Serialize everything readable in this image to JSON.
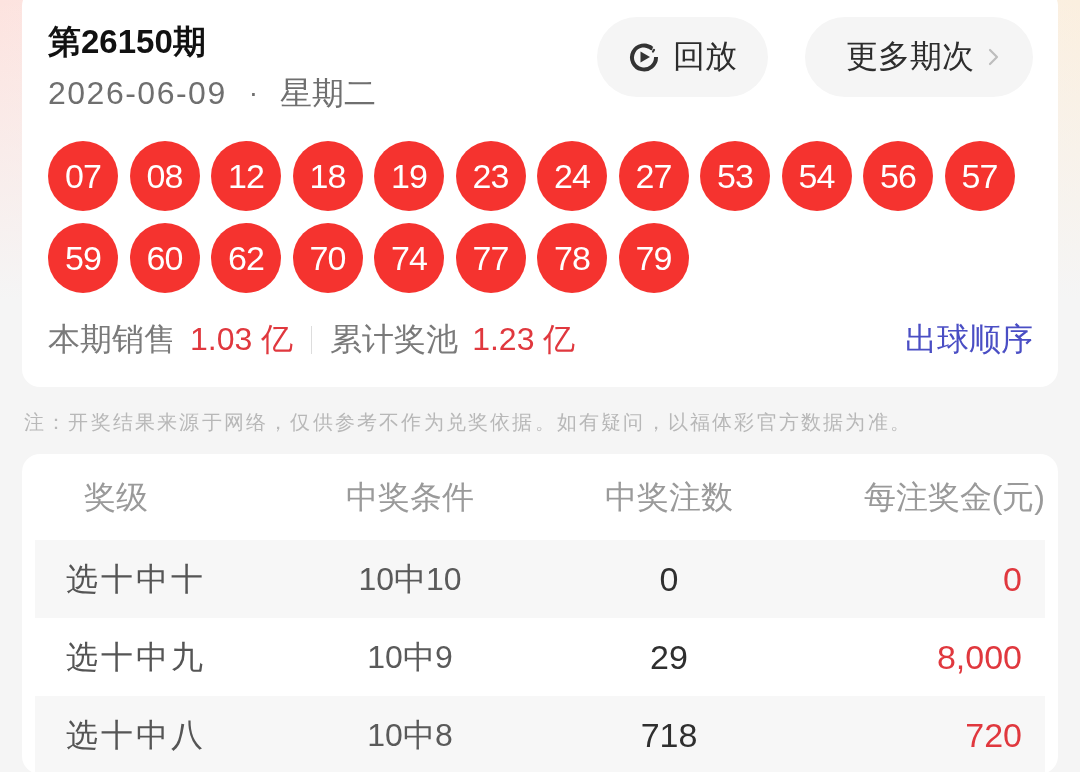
{
  "draw": {
    "issue": "第26150期",
    "date": "2026-06-09",
    "separator": "·",
    "weekday": "星期二"
  },
  "actions": [
    {
      "kind": "replay",
      "label": "回放"
    },
    {
      "kind": "more",
      "label": "更多期次"
    }
  ],
  "balls": [
    "07",
    "08",
    "12",
    "18",
    "19",
    "23",
    "24",
    "27",
    "53",
    "54",
    "56",
    "57",
    "59",
    "60",
    "62",
    "70",
    "74",
    "77",
    "78",
    "79"
  ],
  "stats": [
    {
      "label": "本期销售",
      "value": "1.03 亿"
    },
    {
      "label": "累计奖池",
      "value": "1.23 亿"
    }
  ],
  "order_link": "出球顺序",
  "note": "注：开奖结果来源于网络，仅供参考不作为兑奖依据。如有疑问，以福体彩官方数据为准。",
  "table": {
    "columns": [
      "奖级",
      "中奖条件",
      "中奖注数",
      "每注奖金(元)"
    ],
    "rows": [
      {
        "level": "选十中十",
        "condition": "10中10",
        "count": "0",
        "prize": "0"
      },
      {
        "level": "选十中九",
        "condition": "10中9",
        "count": "29",
        "prize": "8,000"
      },
      {
        "level": "选十中八",
        "condition": "10中8",
        "count": "718",
        "prize": "720"
      }
    ]
  }
}
